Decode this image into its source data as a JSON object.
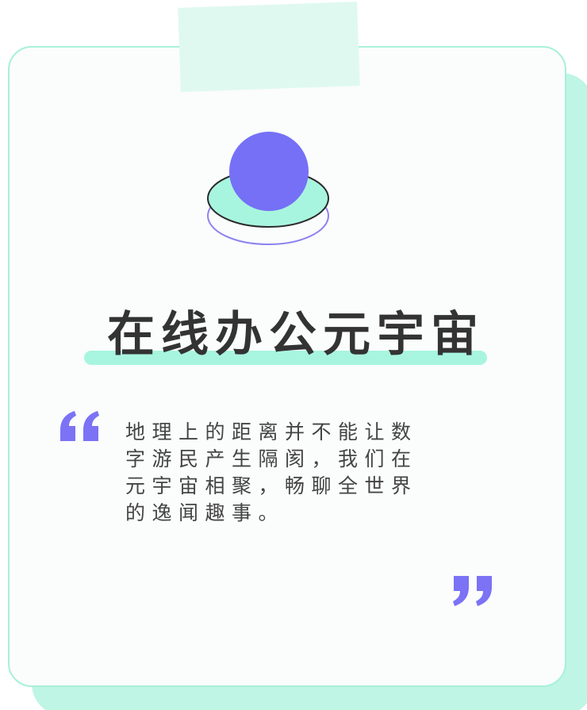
{
  "title": "在线办公元宇宙",
  "body": "地理上的距离并不能让数字游民产生隔阂，我们在元宇宙相聚，畅聊全世界的逸闻趣事。",
  "colors": {
    "accent_purple": "#7b72f5",
    "accent_mint": "#a8f5df",
    "card_border": "#a8f0da",
    "text_dark": "#333333"
  },
  "icons": {
    "open_quote": "open-quote-icon",
    "close_quote": "close-quote-icon",
    "orb": "planet-orb-icon"
  }
}
